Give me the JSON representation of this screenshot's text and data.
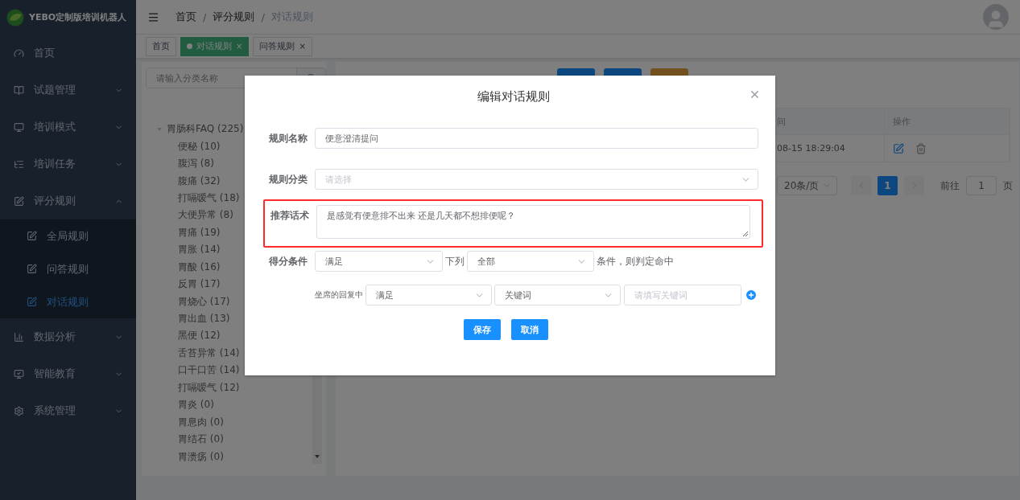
{
  "app": {
    "title": "YEBO定制版培训机器人"
  },
  "sidebar": {
    "items": [
      {
        "label": "首页",
        "expandable": false,
        "selected": false
      },
      {
        "label": "试题管理",
        "expandable": true,
        "expanded": false,
        "selected": false
      },
      {
        "label": "培训模式",
        "expandable": true,
        "expanded": false,
        "selected": false
      },
      {
        "label": "培训任务",
        "expandable": true,
        "expanded": false,
        "selected": false
      },
      {
        "label": "评分规则",
        "expandable": true,
        "expanded": true,
        "selected": false,
        "children": [
          {
            "label": "全局规则",
            "selected": false
          },
          {
            "label": "问答规则",
            "selected": false
          },
          {
            "label": "对话规则",
            "selected": true
          }
        ]
      },
      {
        "label": "数据分析",
        "expandable": true,
        "expanded": false,
        "selected": false
      },
      {
        "label": "智能教育",
        "expandable": true,
        "expanded": false,
        "selected": false
      },
      {
        "label": "系统管理",
        "expandable": true,
        "expanded": false,
        "selected": false
      }
    ]
  },
  "breadcrumb": [
    "首页",
    "评分规则",
    "对话规则"
  ],
  "breadcrumb_separator": "/",
  "tags": [
    {
      "label": "首页",
      "selected": false,
      "closable": false
    },
    {
      "label": "对话规则",
      "selected": true,
      "closable": true
    },
    {
      "label": "问答规则",
      "selected": false,
      "closable": true
    }
  ],
  "close_mark": "×",
  "tree": {
    "search_placeholder": "请输入分类名称",
    "root": {
      "label": "胃肠科FAQ (225)",
      "expanded": true,
      "children": [
        {
          "label": "便秘 (10)"
        },
        {
          "label": "腹泻 (8)"
        },
        {
          "label": "腹痛 (32)"
        },
        {
          "label": "打嗝嗳气 (18)"
        },
        {
          "label": "大便异常 (8)"
        },
        {
          "label": "胃痛 (19)"
        },
        {
          "label": "胃胀 (14)"
        },
        {
          "label": "胃酸 (16)"
        },
        {
          "label": "反胃 (17)"
        },
        {
          "label": "胃烧心 (17)"
        },
        {
          "label": "胃出血 (13)"
        },
        {
          "label": "黑便 (12)"
        },
        {
          "label": "舌苔异常 (14)"
        },
        {
          "label": "口干口苦 (14)"
        },
        {
          "label": "打嗝嗳气 (12)"
        },
        {
          "label": "胃炎 (0)"
        },
        {
          "label": "胃息肉 (0)"
        },
        {
          "label": "胃结石 (0)"
        },
        {
          "label": "胃溃疡 (0)"
        }
      ]
    }
  },
  "toolbar": {
    "buttons": [
      {
        "kind": "primary"
      },
      {
        "kind": "primary"
      },
      {
        "kind": "warning"
      }
    ]
  },
  "table": {
    "columns": [
      "间",
      "操作"
    ],
    "rows": [
      {
        "cells": [
          "08-15 18:29:04"
        ]
      }
    ]
  },
  "pagination": {
    "page_size": "20条/页",
    "pages": [
      {
        "label": "1",
        "selected": true
      }
    ],
    "goto_label": "前往",
    "goto_value": "1",
    "page_unit": "页"
  },
  "dialog": {
    "title": "编辑对话规则",
    "name_field": {
      "label": "规则名称",
      "value": "便意澄清提问"
    },
    "category_field": {
      "label": "规则分类",
      "placeholder": "请选择"
    },
    "script_field": {
      "label": "推荐话术",
      "value": "是感觉有便意排不出来 还是几天都不想排便呢？",
      "highlighted": true
    },
    "score": {
      "label": "得分条件",
      "select_1": "满足",
      "between": "下列",
      "select_2": "全部",
      "suffix": "条件，则判定命中"
    },
    "condition": {
      "label": "坐席的回复中",
      "select_1": "满足",
      "select_2": "关键词",
      "keyword_placeholder": "请填写关键词"
    },
    "buttons": [
      "保存",
      "取消"
    ]
  }
}
